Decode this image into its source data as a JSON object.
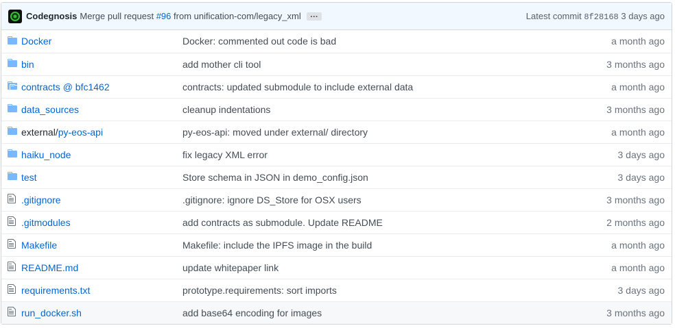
{
  "commit": {
    "author": "Codegnosis",
    "message_prefix": "Merge pull request",
    "pr_number": "#96",
    "message_suffix": "from unification-com/legacy_xml",
    "ellipsis": "…",
    "latest_label": "Latest commit",
    "sha": "8f28168",
    "age": "3 days ago"
  },
  "files": [
    {
      "icon": "folder-icon",
      "name": "Docker",
      "name_suffix": "",
      "message": "Docker: commented out code is bad",
      "age": "a month ago"
    },
    {
      "icon": "folder-icon",
      "name": "bin",
      "name_suffix": "",
      "message": "add mother cli tool",
      "age": "3 months ago"
    },
    {
      "icon": "submodule-icon",
      "name": "contracts @ bfc1462",
      "name_suffix": "",
      "message": "contracts: updated submodule to include external data",
      "age": "a month ago"
    },
    {
      "icon": "folder-icon",
      "name": "data_sources",
      "name_suffix": "",
      "message": "cleanup indentations",
      "age": "3 months ago"
    },
    {
      "icon": "folder-icon",
      "name": "external/",
      "name_suffix": "py-eos-api",
      "message": "py-eos-api: moved under external/ directory",
      "age": "a month ago"
    },
    {
      "icon": "folder-icon",
      "name": "haiku_node",
      "name_suffix": "",
      "message": "fix legacy XML error",
      "age": "3 days ago"
    },
    {
      "icon": "folder-icon",
      "name": "test",
      "name_suffix": "",
      "message": "Store schema in JSON in demo_config.json",
      "age": "3 days ago"
    },
    {
      "icon": "file-icon",
      "name": ".gitignore",
      "name_suffix": "",
      "message": ".gitignore: ignore DS_Store for OSX users",
      "age": "3 months ago"
    },
    {
      "icon": "file-icon",
      "name": ".gitmodules",
      "name_suffix": "",
      "message": "add contracts as submodule. Update README",
      "age": "2 months ago"
    },
    {
      "icon": "file-icon",
      "name": "Makefile",
      "name_suffix": "",
      "message": "Makefile: include the IPFS image in the build",
      "age": "a month ago"
    },
    {
      "icon": "file-icon",
      "name": "README.md",
      "name_suffix": "",
      "message": "update whitepaper link",
      "age": "a month ago"
    },
    {
      "icon": "file-icon",
      "name": "requirements.txt",
      "name_suffix": "",
      "message": "prototype.requirements: sort imports",
      "age": "3 days ago"
    },
    {
      "icon": "file-icon",
      "name": "run_docker.sh",
      "name_suffix": "",
      "message": "add base64 encoding for images",
      "age": "3 months ago"
    }
  ],
  "colors": {
    "link": "#0366d6",
    "icon": "#79b8ff",
    "commit_bar": "#f1f8ff"
  }
}
